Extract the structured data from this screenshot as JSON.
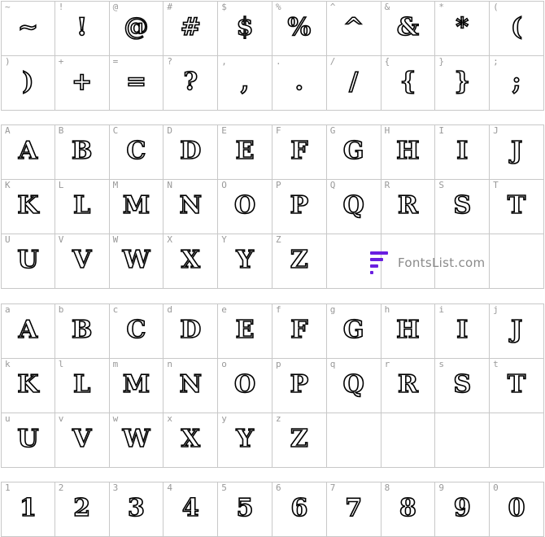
{
  "symbols": [
    [
      {
        "k": "~",
        "g": "~"
      },
      {
        "k": "!",
        "g": "!"
      },
      {
        "k": "@",
        "g": "@"
      },
      {
        "k": "#",
        "g": "#"
      },
      {
        "k": "$",
        "g": "$"
      },
      {
        "k": "%",
        "g": "%"
      },
      {
        "k": "^",
        "g": "^"
      },
      {
        "k": "&",
        "g": "&"
      },
      {
        "k": "*",
        "g": "*"
      },
      {
        "k": "(",
        "g": "("
      }
    ],
    [
      {
        "k": ")",
        "g": ")"
      },
      {
        "k": "+",
        "g": "+"
      },
      {
        "k": "=",
        "g": "="
      },
      {
        "k": "?",
        "g": "?"
      },
      {
        "k": ",",
        "g": ","
      },
      {
        "k": ".",
        "g": "."
      },
      {
        "k": "/",
        "g": "/"
      },
      {
        "k": "{",
        "g": "{"
      },
      {
        "k": "}",
        "g": "}"
      },
      {
        "k": ";",
        "g": ";"
      }
    ]
  ],
  "upper": [
    [
      {
        "k": "A",
        "g": "A"
      },
      {
        "k": "B",
        "g": "B"
      },
      {
        "k": "C",
        "g": "C"
      },
      {
        "k": "D",
        "g": "D"
      },
      {
        "k": "E",
        "g": "E"
      },
      {
        "k": "F",
        "g": "F"
      },
      {
        "k": "G",
        "g": "G"
      },
      {
        "k": "H",
        "g": "H"
      },
      {
        "k": "I",
        "g": "I"
      },
      {
        "k": "J",
        "g": "J"
      }
    ],
    [
      {
        "k": "K",
        "g": "K"
      },
      {
        "k": "L",
        "g": "L"
      },
      {
        "k": "M",
        "g": "M"
      },
      {
        "k": "N",
        "g": "N"
      },
      {
        "k": "O",
        "g": "O"
      },
      {
        "k": "P",
        "g": "P"
      },
      {
        "k": "Q",
        "g": "Q"
      },
      {
        "k": "R",
        "g": "R"
      },
      {
        "k": "S",
        "g": "S"
      },
      {
        "k": "T",
        "g": "T"
      }
    ],
    [
      {
        "k": "U",
        "g": "U"
      },
      {
        "k": "V",
        "g": "V"
      },
      {
        "k": "W",
        "g": "W"
      },
      {
        "k": "X",
        "g": "X"
      },
      {
        "k": "Y",
        "g": "Y"
      },
      {
        "k": "Z",
        "g": "Z"
      }
    ]
  ],
  "lower": [
    [
      {
        "k": "a",
        "g": "A"
      },
      {
        "k": "b",
        "g": "B"
      },
      {
        "k": "c",
        "g": "C"
      },
      {
        "k": "d",
        "g": "D"
      },
      {
        "k": "e",
        "g": "E"
      },
      {
        "k": "f",
        "g": "F"
      },
      {
        "k": "g",
        "g": "G"
      },
      {
        "k": "h",
        "g": "H"
      },
      {
        "k": "i",
        "g": "I"
      },
      {
        "k": "j",
        "g": "J"
      }
    ],
    [
      {
        "k": "k",
        "g": "K"
      },
      {
        "k": "l",
        "g": "L"
      },
      {
        "k": "m",
        "g": "M"
      },
      {
        "k": "n",
        "g": "N"
      },
      {
        "k": "o",
        "g": "O"
      },
      {
        "k": "p",
        "g": "P"
      },
      {
        "k": "q",
        "g": "Q"
      },
      {
        "k": "r",
        "g": "R"
      },
      {
        "k": "s",
        "g": "S"
      },
      {
        "k": "t",
        "g": "T"
      }
    ],
    [
      {
        "k": "u",
        "g": "U"
      },
      {
        "k": "v",
        "g": "V"
      },
      {
        "k": "w",
        "g": "W"
      },
      {
        "k": "x",
        "g": "X"
      },
      {
        "k": "y",
        "g": "Y"
      },
      {
        "k": "z",
        "g": "Z"
      }
    ]
  ],
  "digits": [
    [
      {
        "k": "1",
        "g": "1"
      },
      {
        "k": "2",
        "g": "2"
      },
      {
        "k": "3",
        "g": "3"
      },
      {
        "k": "4",
        "g": "4"
      },
      {
        "k": "5",
        "g": "5"
      },
      {
        "k": "6",
        "g": "6"
      },
      {
        "k": "7",
        "g": "7"
      },
      {
        "k": "8",
        "g": "8"
      },
      {
        "k": "9",
        "g": "9"
      },
      {
        "k": "0",
        "g": "0"
      }
    ]
  ],
  "logo": {
    "text": "FontsList.com",
    "icon": "fontslist-logo-icon",
    "color": "#6a1fe0"
  }
}
